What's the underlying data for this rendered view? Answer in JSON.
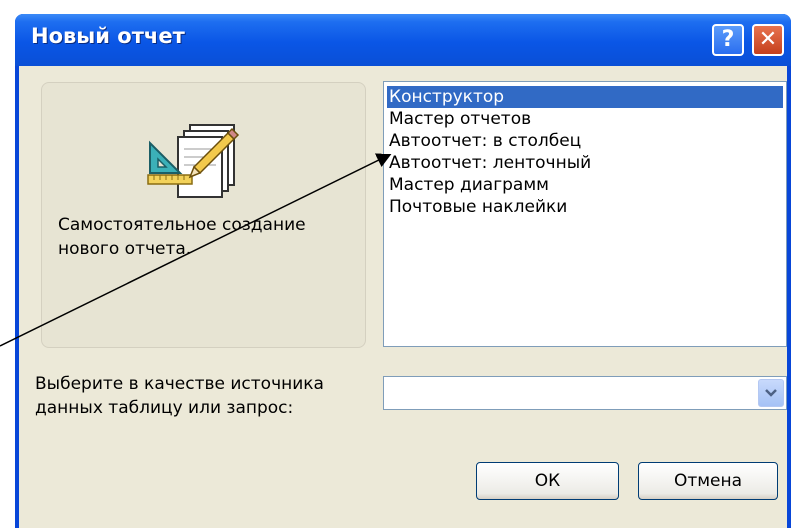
{
  "window": {
    "title": "Новый отчет",
    "help_label": "?",
    "close_label": "✕"
  },
  "preview": {
    "icon": "report-design-icon",
    "description": "Самостоятельное создание нового отчета."
  },
  "report_types": {
    "items": [
      {
        "label": "Конструктор",
        "selected": true
      },
      {
        "label": "Мастер отчетов",
        "selected": false
      },
      {
        "label": "Автоотчет: в столбец",
        "selected": false
      },
      {
        "label": "Автоотчет: ленточный",
        "selected": false
      },
      {
        "label": "Мастер диаграмм",
        "selected": false
      },
      {
        "label": "Почтовые наклейки",
        "selected": false
      }
    ]
  },
  "data_source": {
    "label": "Выберите в качестве источника данных таблицу или запрос:",
    "value": "",
    "dropdown_icon": "chevron-down-icon"
  },
  "buttons": {
    "ok": "ОК",
    "cancel": "Отмена"
  },
  "colors": {
    "title_bar": "#0a56e6",
    "dialog_bg": "#ece9d8",
    "selection": "#316ac5"
  }
}
